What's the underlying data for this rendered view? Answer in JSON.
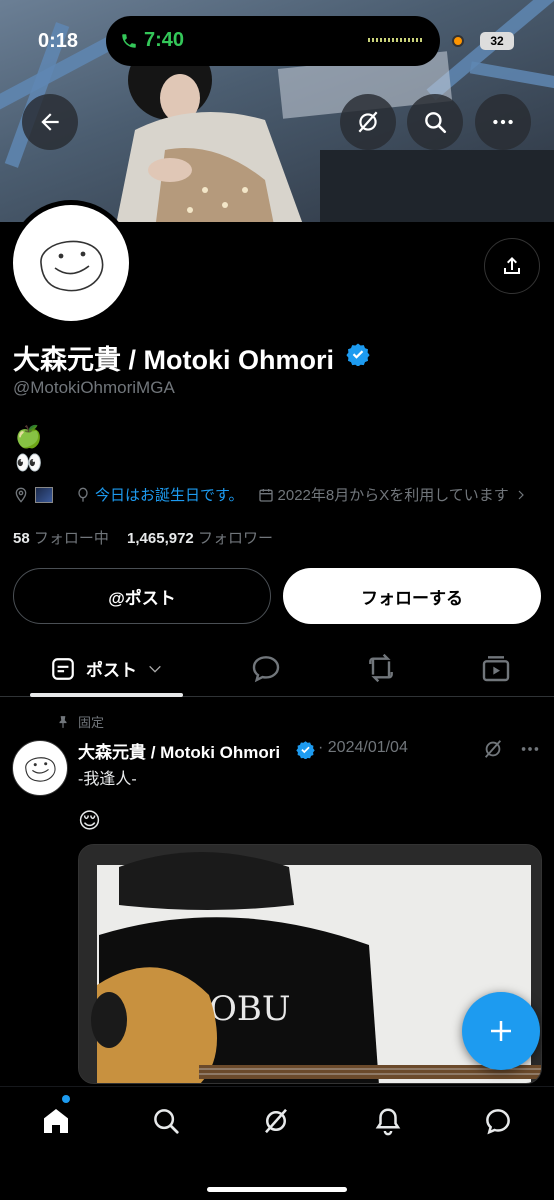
{
  "status_bar": {
    "time": "0:18",
    "call_time": "7:40",
    "battery": "32"
  },
  "profile": {
    "display_name": "大森元貴 / Motoki Ohmori",
    "handle": "@MotokiOhmoriMGA",
    "bio_line1": "🍏",
    "bio_line2": "👀",
    "birthday_text": "今日はお誕生日です。",
    "joined_text": "2022年8月からXを利用しています",
    "following_count": "58",
    "following_label": "フォロー中",
    "followers_count": "1,465,972",
    "followers_label": "フォロワー"
  },
  "actions": {
    "post_button": "@ポスト",
    "follow_button": "フォローする"
  },
  "tabs": {
    "posts_label": "ポスト"
  },
  "pinned_post": {
    "pinned_label": "固定",
    "author": "大森元貴 / Motoki Ohmori",
    "date": "· 2024/01/04",
    "text": "-我逢人-",
    "emoji": "😌"
  },
  "colors": {
    "accent": "#1d9bf0",
    "background": "#000000",
    "secondary_text": "#71767b"
  },
  "icons": [
    "back-arrow-icon",
    "grok-icon",
    "search-icon",
    "more-icon",
    "share-icon",
    "verified-icon",
    "location-icon",
    "balloon-icon",
    "calendar-icon",
    "chevron-right-icon",
    "posts-icon",
    "chevron-down-icon",
    "replies-icon",
    "repost-icon",
    "media-icon",
    "pin-icon",
    "plus-icon",
    "home-icon",
    "notifications-icon",
    "messages-icon"
  ]
}
